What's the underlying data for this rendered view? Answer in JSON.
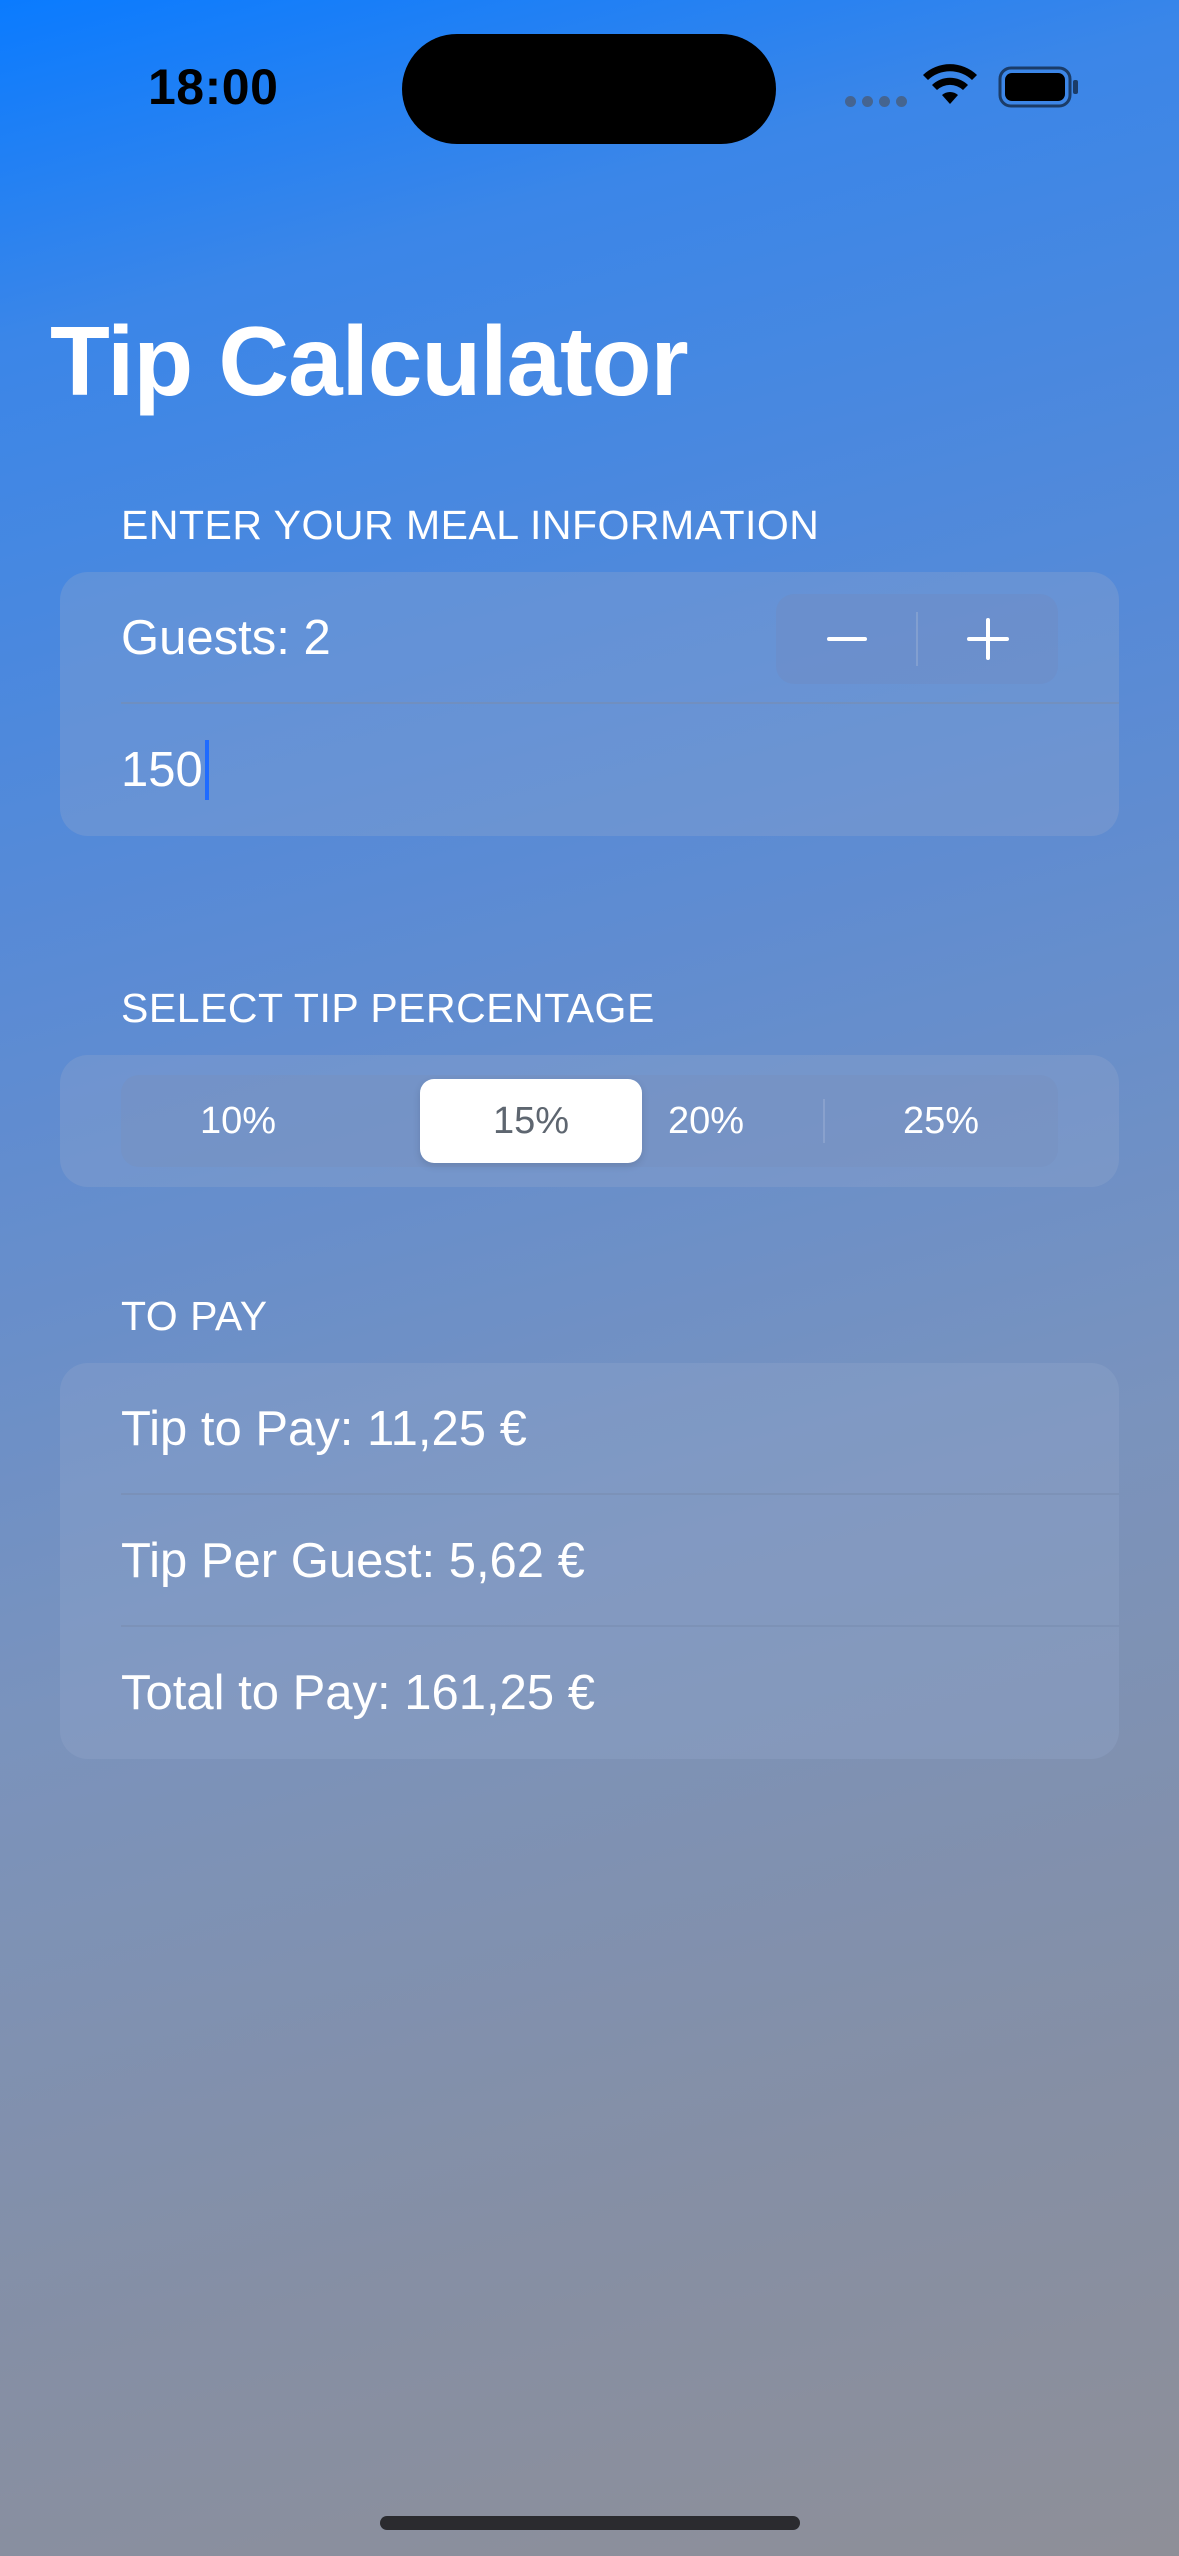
{
  "status_bar": {
    "time": "18:00"
  },
  "page": {
    "title": "Tip Calculator"
  },
  "meal_section": {
    "header": "ENTER YOUR MEAL INFORMATION",
    "guests_label": "Guests: 2",
    "amount_value": "150"
  },
  "tip_section": {
    "header": "SELECT TIP PERCENTAGE",
    "options": [
      "10%",
      "15%",
      "20%",
      "25%"
    ],
    "selected": "15%"
  },
  "pay_section": {
    "header": "TO PAY",
    "tip_to_pay": "Tip to Pay: 11,25 €",
    "tip_per_guest": "Tip Per Guest: 5,62 €",
    "total_to_pay": "Total to Pay: 161,25 €"
  },
  "icons": {
    "stepper_decrement": "minus-icon",
    "stepper_increment": "plus-icon",
    "wifi": "wifi-icon",
    "battery": "battery-icon"
  }
}
